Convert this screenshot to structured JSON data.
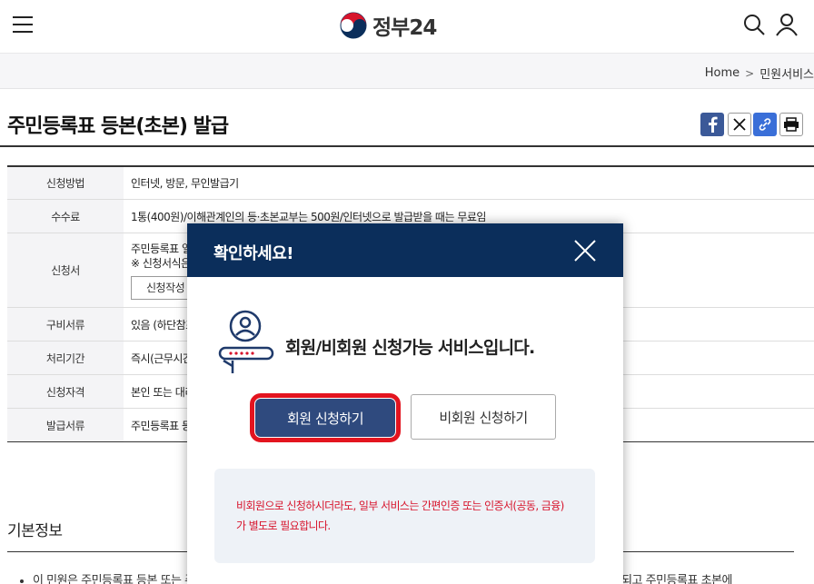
{
  "header": {
    "logo_text": "정부24"
  },
  "breadcrumb": {
    "home": "Home",
    "current": "민원서비스"
  },
  "page": {
    "title": "주민등록표 등본(초본) 발급"
  },
  "info_table": {
    "rows": [
      {
        "label": "신청방법",
        "value": "인터넷, 방문, 무인발급기"
      },
      {
        "label": "수수료",
        "value": "1통(400원)/이해관계인의 등·초본교부는 500원/인터넷으로 발급받을 때는 무료임"
      },
      {
        "label": "신청서",
        "line1": "주민등록표 열",
        "line2": "※ 신청서식은",
        "button": "신청작성"
      },
      {
        "label": "구비서류",
        "value": "있음 (하단참조"
      },
      {
        "label": "처리기간",
        "value": "즉시(근무시간"
      },
      {
        "label": "신청자격",
        "value": "본인 또는 대리"
      },
      {
        "label": "발급서류",
        "value": "주민등록표 등"
      }
    ]
  },
  "section": {
    "title": "기본정보",
    "bottom_left": "이 민원은 주민등록표 등본 또는 주",
    "bottom_right": "항이 표시되고 주민등록표 초본에"
  },
  "modal": {
    "title": "확인하세요!",
    "message": "회원/비회원 신청가능 서비스입니다.",
    "member_button": "회원 신청하기",
    "guest_button": "비회원 신청하기",
    "notice_line1": "비회원으로 신청하시더라도, 일부 서비스는 간편인증 또는 인증서(공동, 금융)",
    "notice_line2": "가 별도로 필요합니다."
  },
  "colors": {
    "modal_header": "#0b2e5b",
    "member_button": "#2f4a7e",
    "highlight": "#e3141f",
    "notice_text": "#d7142c"
  }
}
